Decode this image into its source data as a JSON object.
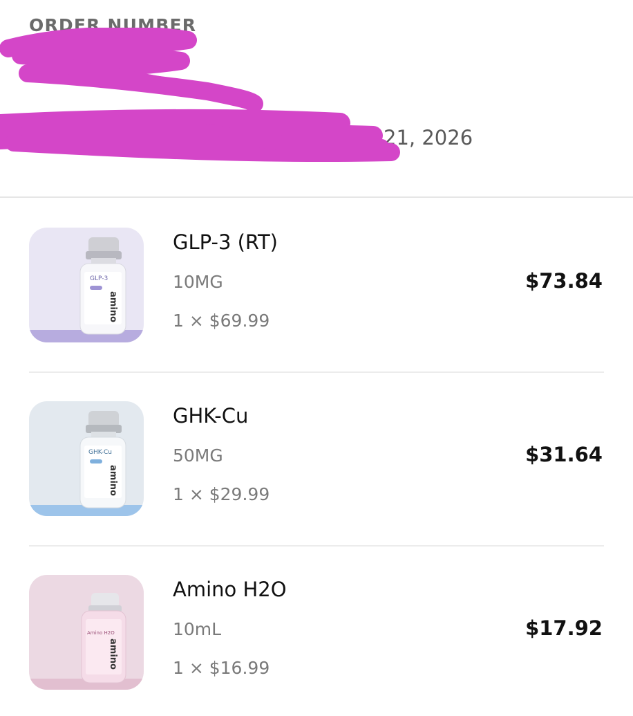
{
  "order": {
    "label": "ORDER NUMBER",
    "date_partial": "21, 2026"
  },
  "items": [
    {
      "name": "GLP-3 (RT)",
      "variant": "10MG",
      "qty_price": "1 × $69.99",
      "total": "$73.84",
      "vial_label": "GLP-3",
      "brand": "amino",
      "bg_color": "#e9e6f4",
      "accent_color": "#b7acdf"
    },
    {
      "name": "GHK-Cu",
      "variant": "50MG",
      "qty_price": "1 × $29.99",
      "total": "$31.64",
      "vial_label": "GHK-Cu",
      "brand": "amino",
      "bg_color": "#e3e9ef",
      "accent_color": "#9dc4ea"
    },
    {
      "name": "Amino H2O",
      "variant": "10mL",
      "qty_price": "1 × $16.99",
      "total": "$17.92",
      "vial_label": "Amino H2O",
      "brand": "amino",
      "bg_color": "#ecd9e3",
      "accent_color": "#e2bfd0"
    }
  ]
}
